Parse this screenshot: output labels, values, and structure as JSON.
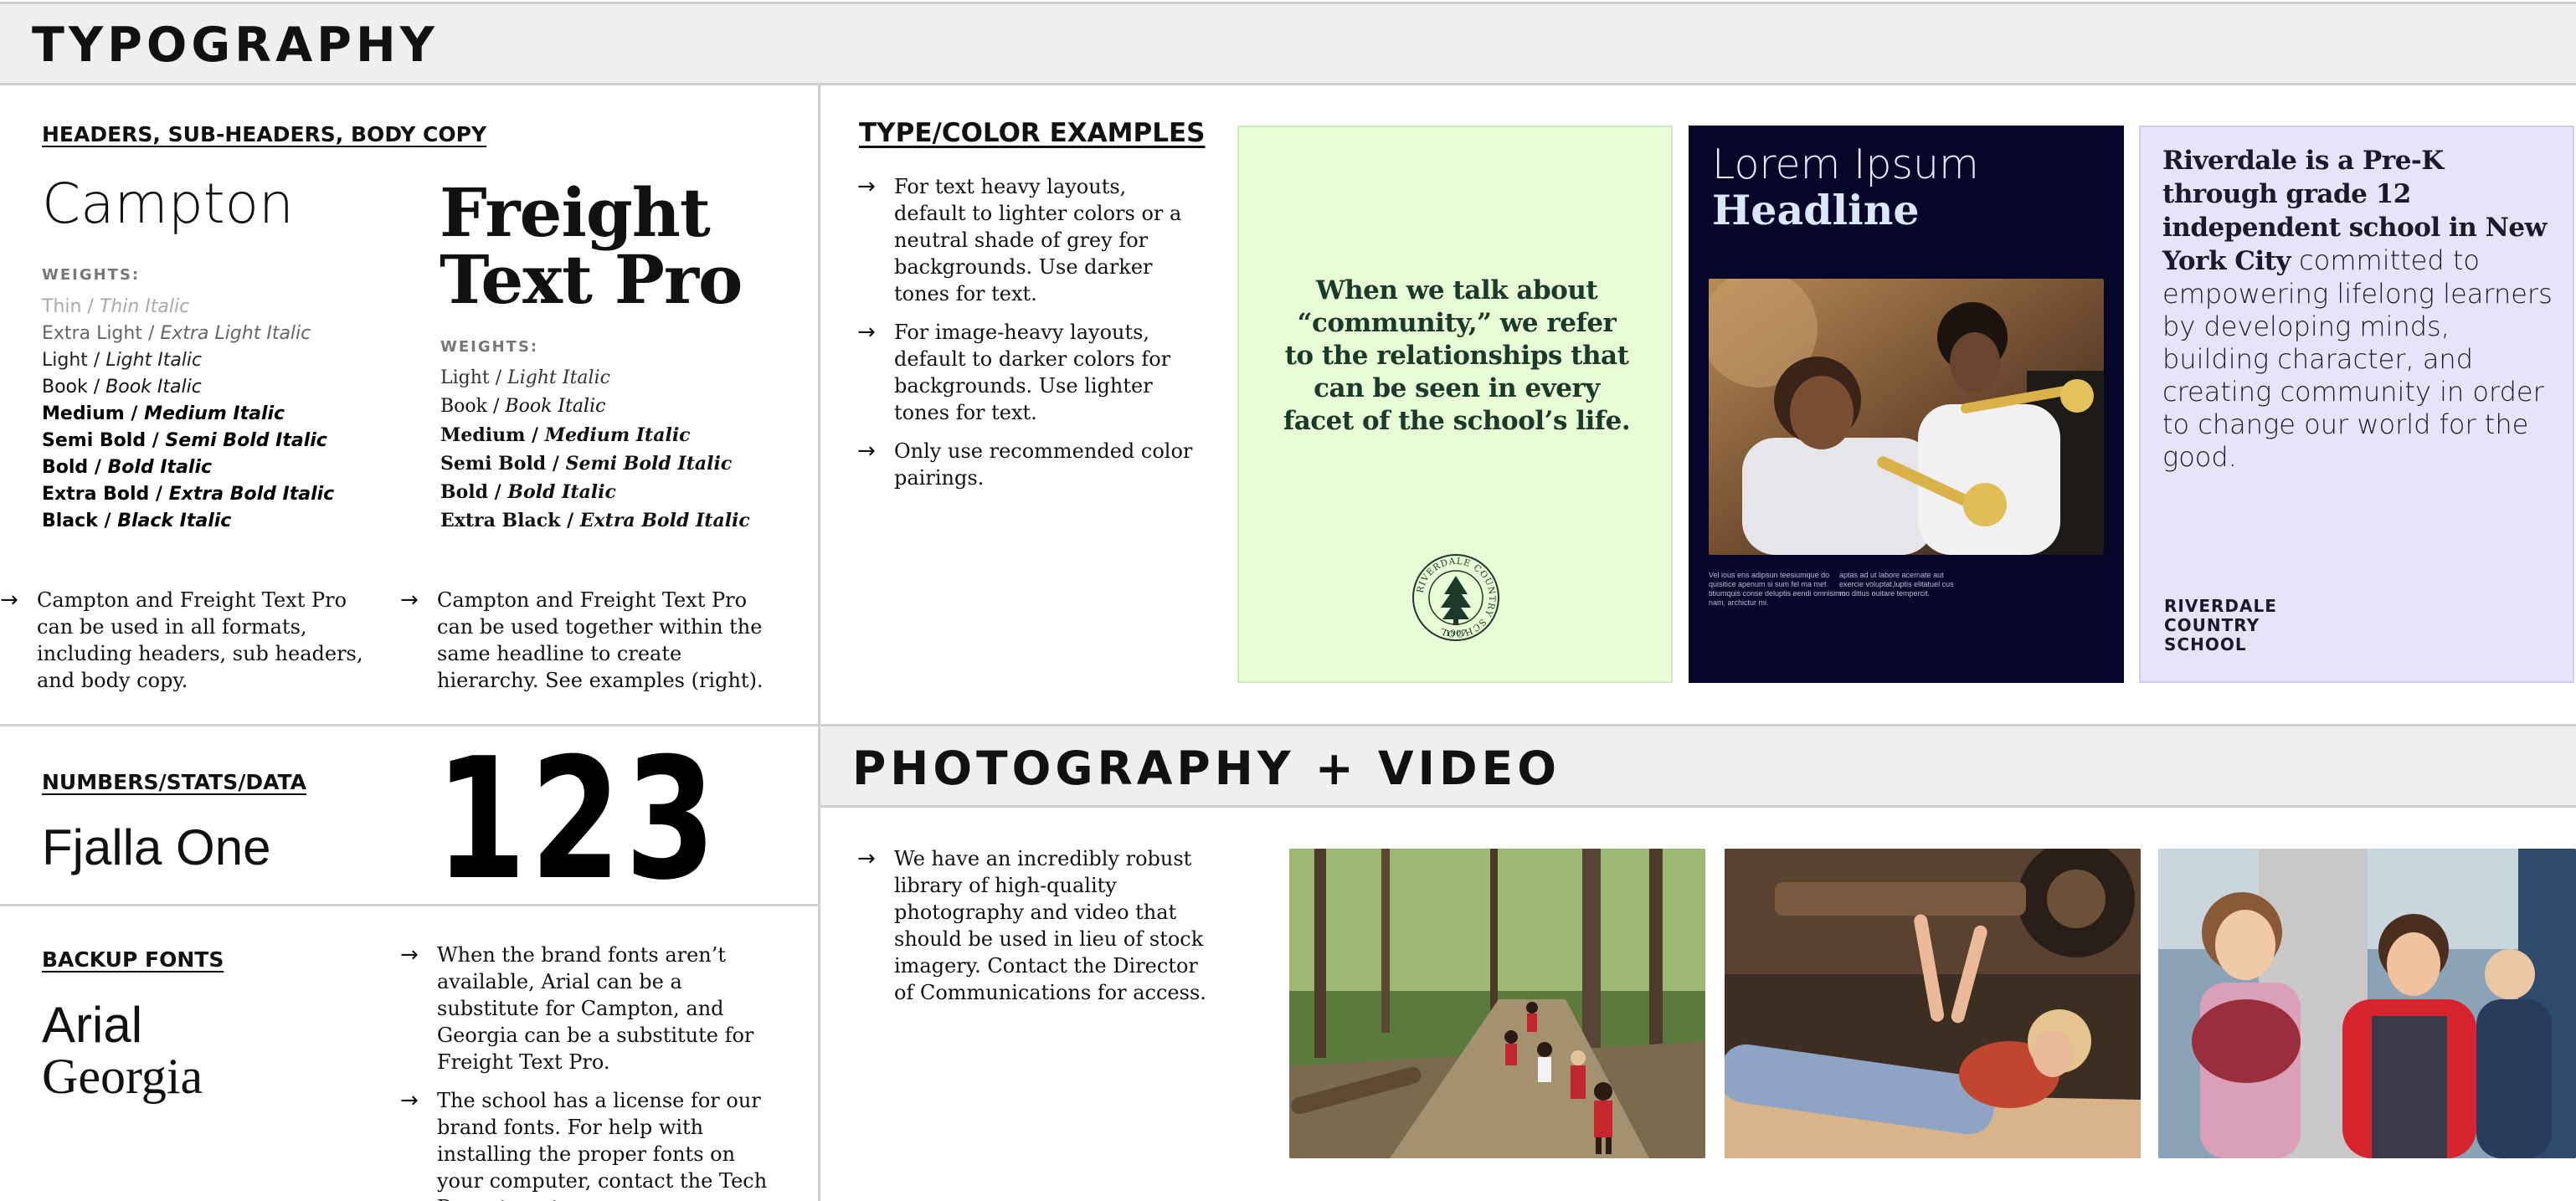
{
  "typography": {
    "title": "TYPOGRAPHY",
    "headers_heading": "HEADERS, SUB-HEADERS, BODY COPY",
    "campton": {
      "name": "Campton",
      "weights_label": "WEIGHTS:",
      "weights": [
        {
          "regular": "Thin",
          "italic": "Thin Italic"
        },
        {
          "regular": "Extra Light",
          "italic": "Extra Light Italic"
        },
        {
          "regular": "Light",
          "italic": "Light Italic"
        },
        {
          "regular": "Book",
          "italic": "Book Italic"
        },
        {
          "regular": "Medium",
          "italic": "Medium Italic"
        },
        {
          "regular": "Semi Bold",
          "italic": "Semi Bold Italic"
        },
        {
          "regular": "Bold",
          "italic": "Bold Italic"
        },
        {
          "regular": "Extra Bold",
          "italic": "Extra Bold Italic"
        },
        {
          "regular": "Black",
          "italic": "Black Italic"
        }
      ],
      "note": "Campton and Freight Text Pro can be used in all formats, including headers, sub headers, and body copy."
    },
    "freight": {
      "name_line1": "Freight",
      "name_line2": "Text Pro",
      "weights_label": "WEIGHTS:",
      "weights": [
        {
          "regular": "Light",
          "italic": "Light Italic"
        },
        {
          "regular": "Book",
          "italic": "Book Italic"
        },
        {
          "regular": "Medium",
          "italic": "Medium Italic"
        },
        {
          "regular": "Semi Bold",
          "italic": "Semi Bold Italic"
        },
        {
          "regular": "Bold",
          "italic": "Bold Italic"
        },
        {
          "regular": "Extra Black",
          "italic": "Extra Bold Italic"
        }
      ],
      "note": "Campton and Freight Text Pro can be used together within the same headline to create hierarchy. See examples (right)."
    },
    "numbers": {
      "heading": "NUMBERS/STATS/DATA",
      "font_name": "Fjalla One",
      "sample": "123"
    },
    "backup": {
      "heading": "BACKUP FONTS",
      "font1": "Arial",
      "font2": "Georgia",
      "bullets": [
        "When the brand fonts aren’t available, Arial can be a substitute for Campton, and Georgia can be a substitute for Freight Text Pro.",
        "The school has a license for our brand fonts. For help with installing the proper fonts on your computer, contact the Tech Department."
      ]
    },
    "type_color": {
      "heading": "TYPE/COLOR EXAMPLES",
      "bullets": [
        "For text heavy layouts, default to lighter colors or a neutral shade of grey for backgrounds. Use darker tones for text.",
        "For image-heavy layouts, default to darker colors for backgrounds. Use lighter tones for text.",
        "Only use recommended color pairings."
      ]
    },
    "example1": {
      "quote": "When we talk about “community,” we refer to the relationships that can be seen in every facet of the school’s life.",
      "seal_text": "RIVERDALE COUNTRY SCHOOL",
      "seal_year": "1907",
      "bg": "#e8fcd6",
      "text_color": "#1b3a2a"
    },
    "example2": {
      "line1": "Lorem Ipsum",
      "line2": "Headline",
      "caption_left": "Vel ious ens adipsun teesiumque do quisitice apenum si sum fel ma met titiumquis conse deluptis eendi omnisimo nam, archictur mi.",
      "caption_right": "aptas ad ut labore acernate aut exercie voluptat,luptis elitatuel cus mo ditius ouitare tempercit.",
      "bg": "#06062a"
    },
    "example3": {
      "bold_text": "Riverdale is a Pre-K through grade 12 independent school in New York City",
      "rest_text": " committed to empowering lifelong learners by developing minds, building character, and creating community in order to change our world for the good.",
      "logo_line1": "RIVERDALE",
      "logo_line2": "COUNTRY",
      "logo_line3": "SCHOOL",
      "bg": "#e6e4fa"
    }
  },
  "photo_video": {
    "title": "PHOTOGRAPHY + VIDEO",
    "bullets": [
      "We have an incredibly robust library of high-quality photography and video that should be used in lieu of stock imagery. Contact the Director of Communications for access."
    ]
  },
  "icons": {
    "bullet": "→"
  }
}
